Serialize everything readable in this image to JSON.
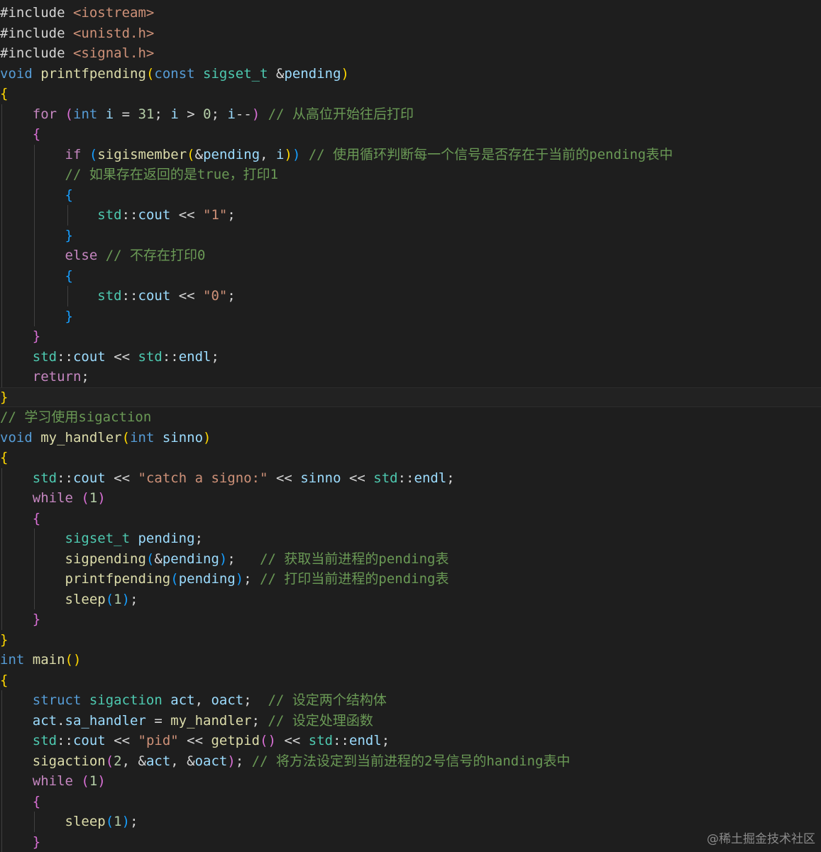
{
  "editor": {
    "theme": {
      "background": "#1e1e1e",
      "keyword": "#569cd6",
      "control": "#c586c0",
      "type": "#4ec9b0",
      "function": "#dcdcaa",
      "variable": "#9cdcfe",
      "string": "#ce9178",
      "number": "#b5cea8",
      "comment": "#6a9955",
      "bracket_1": "#ffd700",
      "bracket_2": "#da70d6",
      "bracket_3": "#179fff"
    },
    "lines": [
      {
        "indent": 0,
        "tokens": [
          [
            "plain",
            "#include "
          ],
          [
            "str",
            "<iostream>"
          ]
        ]
      },
      {
        "indent": 0,
        "tokens": [
          [
            "plain",
            "#include "
          ],
          [
            "str",
            "<unistd.h>"
          ]
        ]
      },
      {
        "indent": 0,
        "tokens": [
          [
            "plain",
            "#include "
          ],
          [
            "str",
            "<signal.h>"
          ]
        ]
      },
      {
        "indent": 0,
        "tokens": [
          [
            "kw",
            "void"
          ],
          [
            "plain",
            " "
          ],
          [
            "fn",
            "printfpending"
          ],
          [
            "b1",
            "("
          ],
          [
            "kw",
            "const"
          ],
          [
            "plain",
            " "
          ],
          [
            "type",
            "sigset_t"
          ],
          [
            "plain",
            " &"
          ],
          [
            "param",
            "pending"
          ],
          [
            "b1",
            ")"
          ]
        ]
      },
      {
        "indent": 0,
        "tokens": [
          [
            "b1",
            "{"
          ]
        ]
      },
      {
        "indent": 1,
        "tokens": [
          [
            "ctrl",
            "for"
          ],
          [
            "plain",
            " "
          ],
          [
            "b2",
            "("
          ],
          [
            "kw",
            "int"
          ],
          [
            "plain",
            " "
          ],
          [
            "var",
            "i"
          ],
          [
            "plain",
            " = "
          ],
          [
            "num",
            "31"
          ],
          [
            "plain",
            "; "
          ],
          [
            "var",
            "i"
          ],
          [
            "plain",
            " > "
          ],
          [
            "num",
            "0"
          ],
          [
            "plain",
            "; "
          ],
          [
            "var",
            "i"
          ],
          [
            "plain",
            "--"
          ],
          [
            "b2",
            ")"
          ],
          [
            "plain",
            " "
          ],
          [
            "cmt",
            "// 从高位开始往后打印"
          ]
        ]
      },
      {
        "indent": 1,
        "tokens": [
          [
            "b2",
            "{"
          ]
        ]
      },
      {
        "indent": 2,
        "tokens": [
          [
            "ctrl",
            "if"
          ],
          [
            "plain",
            " "
          ],
          [
            "b3",
            "("
          ],
          [
            "fn",
            "sigismember"
          ],
          [
            "b1",
            "("
          ],
          [
            "plain",
            "&"
          ],
          [
            "param",
            "pending"
          ],
          [
            "plain",
            ", "
          ],
          [
            "var",
            "i"
          ],
          [
            "b1",
            ")"
          ],
          [
            "b3",
            ")"
          ],
          [
            "plain",
            " "
          ],
          [
            "cmt",
            "// 使用循环判断每一个信号是否存在于当前的pending表中"
          ]
        ]
      },
      {
        "indent": 2,
        "tokens": [
          [
            "cmt",
            "// 如果存在返回的是true，打印1"
          ]
        ]
      },
      {
        "indent": 2,
        "tokens": [
          [
            "b3",
            "{"
          ]
        ]
      },
      {
        "indent": 3,
        "tokens": [
          [
            "type",
            "std"
          ],
          [
            "plain",
            "::"
          ],
          [
            "var",
            "cout"
          ],
          [
            "plain",
            " << "
          ],
          [
            "str",
            "\"1\""
          ],
          [
            "plain",
            ";"
          ]
        ]
      },
      {
        "indent": 2,
        "tokens": [
          [
            "b3",
            "}"
          ]
        ]
      },
      {
        "indent": 2,
        "tokens": [
          [
            "ctrl",
            "else"
          ],
          [
            "plain",
            " "
          ],
          [
            "cmt",
            "// 不存在打印0"
          ]
        ]
      },
      {
        "indent": 2,
        "tokens": [
          [
            "b3",
            "{"
          ]
        ]
      },
      {
        "indent": 3,
        "tokens": [
          [
            "type",
            "std"
          ],
          [
            "plain",
            "::"
          ],
          [
            "var",
            "cout"
          ],
          [
            "plain",
            " << "
          ],
          [
            "str",
            "\"0\""
          ],
          [
            "plain",
            ";"
          ]
        ]
      },
      {
        "indent": 2,
        "tokens": [
          [
            "b3",
            "}"
          ]
        ]
      },
      {
        "indent": 1,
        "tokens": [
          [
            "b2",
            "}"
          ]
        ]
      },
      {
        "indent": 1,
        "tokens": [
          [
            "type",
            "std"
          ],
          [
            "plain",
            "::"
          ],
          [
            "var",
            "cout"
          ],
          [
            "plain",
            " << "
          ],
          [
            "type",
            "std"
          ],
          [
            "plain",
            "::"
          ],
          [
            "var",
            "endl"
          ],
          [
            "plain",
            ";"
          ]
        ]
      },
      {
        "indent": 1,
        "tokens": [
          [
            "ctrl",
            "return"
          ],
          [
            "plain",
            ";"
          ]
        ]
      },
      {
        "indent": 0,
        "current": true,
        "tokens": [
          [
            "b1",
            "}"
          ]
        ]
      },
      {
        "indent": 0,
        "tokens": [
          [
            "cmt",
            "// 学习使用sigaction"
          ]
        ]
      },
      {
        "indent": 0,
        "tokens": [
          [
            "kw",
            "void"
          ],
          [
            "plain",
            " "
          ],
          [
            "fn",
            "my_handler"
          ],
          [
            "b1",
            "("
          ],
          [
            "kw",
            "int"
          ],
          [
            "plain",
            " "
          ],
          [
            "param",
            "sinno"
          ],
          [
            "b1",
            ")"
          ]
        ]
      },
      {
        "indent": 0,
        "tokens": [
          [
            "b1",
            "{"
          ]
        ]
      },
      {
        "indent": 1,
        "tokens": [
          [
            "type",
            "std"
          ],
          [
            "plain",
            "::"
          ],
          [
            "var",
            "cout"
          ],
          [
            "plain",
            " << "
          ],
          [
            "str",
            "\"catch a signo:\""
          ],
          [
            "plain",
            " << "
          ],
          [
            "param",
            "sinno"
          ],
          [
            "plain",
            " << "
          ],
          [
            "type",
            "std"
          ],
          [
            "plain",
            "::"
          ],
          [
            "var",
            "endl"
          ],
          [
            "plain",
            ";"
          ]
        ]
      },
      {
        "indent": 1,
        "tokens": [
          [
            "ctrl",
            "while"
          ],
          [
            "plain",
            " "
          ],
          [
            "b2",
            "("
          ],
          [
            "num",
            "1"
          ],
          [
            "b2",
            ")"
          ]
        ]
      },
      {
        "indent": 1,
        "tokens": [
          [
            "b2",
            "{"
          ]
        ]
      },
      {
        "indent": 2,
        "tokens": [
          [
            "type",
            "sigset_t"
          ],
          [
            "plain",
            " "
          ],
          [
            "var",
            "pending"
          ],
          [
            "plain",
            ";"
          ]
        ]
      },
      {
        "indent": 2,
        "tokens": [
          [
            "fn",
            "sigpending"
          ],
          [
            "b3",
            "("
          ],
          [
            "plain",
            "&"
          ],
          [
            "var",
            "pending"
          ],
          [
            "b3",
            ")"
          ],
          [
            "plain",
            ";   "
          ],
          [
            "cmt",
            "// 获取当前进程的pending表"
          ]
        ]
      },
      {
        "indent": 2,
        "tokens": [
          [
            "fn",
            "printfpending"
          ],
          [
            "b3",
            "("
          ],
          [
            "var",
            "pending"
          ],
          [
            "b3",
            ")"
          ],
          [
            "plain",
            "; "
          ],
          [
            "cmt",
            "// 打印当前进程的pending表"
          ]
        ]
      },
      {
        "indent": 2,
        "tokens": [
          [
            "fn",
            "sleep"
          ],
          [
            "b3",
            "("
          ],
          [
            "num",
            "1"
          ],
          [
            "b3",
            ")"
          ],
          [
            "plain",
            ";"
          ]
        ]
      },
      {
        "indent": 1,
        "tokens": [
          [
            "b2",
            "}"
          ]
        ]
      },
      {
        "indent": 0,
        "tokens": [
          [
            "b1",
            "}"
          ]
        ]
      },
      {
        "indent": 0,
        "tokens": [
          [
            "kw",
            "int"
          ],
          [
            "plain",
            " "
          ],
          [
            "fn",
            "main"
          ],
          [
            "b1",
            "()"
          ]
        ]
      },
      {
        "indent": 0,
        "tokens": [
          [
            "b1",
            "{"
          ]
        ]
      },
      {
        "indent": 1,
        "tokens": [
          [
            "kw",
            "struct"
          ],
          [
            "plain",
            " "
          ],
          [
            "type",
            "sigaction"
          ],
          [
            "plain",
            " "
          ],
          [
            "var",
            "act"
          ],
          [
            "plain",
            ", "
          ],
          [
            "var",
            "oact"
          ],
          [
            "plain",
            ";  "
          ],
          [
            "cmt",
            "// 设定两个结构体"
          ]
        ]
      },
      {
        "indent": 1,
        "tokens": [
          [
            "var",
            "act"
          ],
          [
            "plain",
            "."
          ],
          [
            "var",
            "sa_handler"
          ],
          [
            "plain",
            " = "
          ],
          [
            "fn",
            "my_handler"
          ],
          [
            "plain",
            "; "
          ],
          [
            "cmt",
            "// 设定处理函数"
          ]
        ]
      },
      {
        "indent": 1,
        "tokens": [
          [
            "type",
            "std"
          ],
          [
            "plain",
            "::"
          ],
          [
            "var",
            "cout"
          ],
          [
            "plain",
            " << "
          ],
          [
            "str",
            "\"pid\""
          ],
          [
            "plain",
            " << "
          ],
          [
            "fn",
            "getpid"
          ],
          [
            "b2",
            "()"
          ],
          [
            "plain",
            " << "
          ],
          [
            "type",
            "std"
          ],
          [
            "plain",
            "::"
          ],
          [
            "var",
            "endl"
          ],
          [
            "plain",
            ";"
          ]
        ]
      },
      {
        "indent": 1,
        "tokens": [
          [
            "fn",
            "sigaction"
          ],
          [
            "b2",
            "("
          ],
          [
            "num",
            "2"
          ],
          [
            "plain",
            ", &"
          ],
          [
            "var",
            "act"
          ],
          [
            "plain",
            ", &"
          ],
          [
            "var",
            "oact"
          ],
          [
            "b2",
            ")"
          ],
          [
            "plain",
            "; "
          ],
          [
            "cmt",
            "// 将方法设定到当前进程的2号信号的handing表中"
          ]
        ]
      },
      {
        "indent": 1,
        "tokens": [
          [
            "ctrl",
            "while"
          ],
          [
            "plain",
            " "
          ],
          [
            "b2",
            "("
          ],
          [
            "num",
            "1"
          ],
          [
            "b2",
            ")"
          ]
        ]
      },
      {
        "indent": 1,
        "tokens": [
          [
            "b2",
            "{"
          ]
        ]
      },
      {
        "indent": 2,
        "tokens": [
          [
            "fn",
            "sleep"
          ],
          [
            "b3",
            "("
          ],
          [
            "num",
            "1"
          ],
          [
            "b3",
            ")"
          ],
          [
            "plain",
            ";"
          ]
        ]
      },
      {
        "indent": 1,
        "tokens": [
          [
            "b2",
            "}"
          ]
        ]
      }
    ]
  },
  "watermark": "@稀土掘金技术社区"
}
